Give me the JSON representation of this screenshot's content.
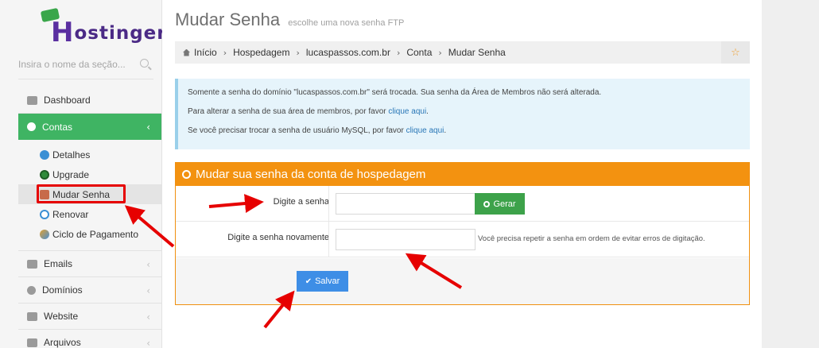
{
  "brand": {
    "name_rest": "ostinger",
    "name_first": "H",
    "accent": "#3fb463"
  },
  "search": {
    "placeholder": "Insira o nome da seção..."
  },
  "sidebar": {
    "items": [
      {
        "label": "Dashboard",
        "icon": "dashboard-icon"
      },
      {
        "label": "Contas",
        "icon": "info-icon",
        "active": true
      },
      {
        "label": "Emails",
        "icon": "envelope-icon"
      },
      {
        "label": "Domínios",
        "icon": "globe-icon"
      },
      {
        "label": "Website",
        "icon": "desktop-icon"
      },
      {
        "label": "Arquivos",
        "icon": "folder-icon"
      }
    ],
    "chevron": "‹",
    "sub": [
      {
        "label": "Detalhes",
        "icon": "info-circle-icon"
      },
      {
        "label": "Upgrade",
        "icon": "upgrade-icon"
      },
      {
        "label": "Mudar Senha",
        "icon": "home-lock-icon",
        "active": true
      },
      {
        "label": "Renovar",
        "icon": "refresh-icon"
      },
      {
        "label": "Ciclo de Pagamento",
        "icon": "cycle-icon"
      }
    ]
  },
  "page": {
    "title": "Mudar Senha",
    "subtitle": "escolhe uma nova senha FTP"
  },
  "breadcrumb": {
    "items": [
      "Início",
      "Hospedagem",
      "lucaspassos.com.br",
      "Conta",
      "Mudar Senha"
    ],
    "separator": "›",
    "star": "☆"
  },
  "info": {
    "line1": "Somente a senha do domínio \"lucaspassos.com.br\" será trocada. Sua senha da Área de Membros não será alterada.",
    "line2_text": "Para alterar a senha de sua área de membros, por favor ",
    "line2_link": "clique aqui",
    "line2_end": ".",
    "line3_text": "Se você precisar trocar a senha de usuário MySQL, por favor ",
    "line3_link": "clique aqui",
    "line3_end": "."
  },
  "form": {
    "title": "Mudar sua senha da conta de hospedagem",
    "label_password": "Digite a senha",
    "label_repeat": "Digite a senha novamente",
    "generate": "Gerar",
    "hint": "Você precisa repetir a senha em ordem de evitar erros de digitação.",
    "save": "Salvar",
    "save_check": "✔"
  },
  "colors": {
    "panel": "#f39210",
    "annotation": "#e60000",
    "save": "#3e8ee6",
    "generate": "#3da24a"
  }
}
